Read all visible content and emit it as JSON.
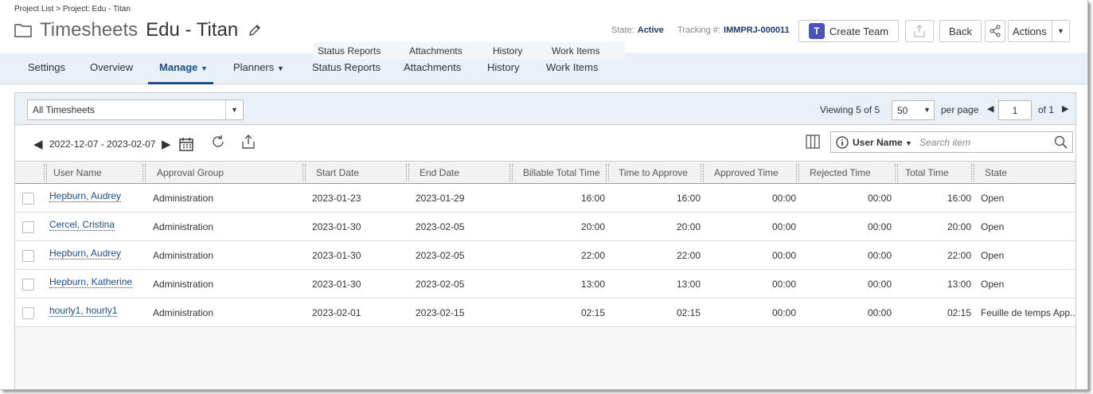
{
  "breadcrumb": "Project List > Project: Edu - Titan",
  "title": {
    "main": "Timesheets",
    "sub": "Edu - Titan"
  },
  "state": {
    "label": "State:",
    "value": "Active"
  },
  "tracking": {
    "label": "Tracking #:",
    "value": "IMMPRJ-000011"
  },
  "buttons": {
    "create_team": "Create Team",
    "back": "Back",
    "actions": "Actions"
  },
  "floating_tabs": [
    "Status Reports",
    "Attachments",
    "History",
    "Work Items"
  ],
  "nav": {
    "settings": "Settings",
    "overview": "Overview",
    "manage": "Manage",
    "planners": "Planners",
    "status_reports": "Status Reports",
    "attachments": "Attachments",
    "history": "History",
    "work_items": "Work Items"
  },
  "filter": {
    "selected": "All Timesheets"
  },
  "paging": {
    "viewing_label": "Viewing",
    "viewing": "5 of 5",
    "per_page_value": "50",
    "per_page_label": "per page",
    "page": "1",
    "of": "of 1"
  },
  "date_range": "2022-12-07 - 2023-02-07",
  "search": {
    "field": "User Name",
    "placeholder": "Search item"
  },
  "columns": [
    "User Name",
    "Approval Group",
    "Start Date",
    "End Date",
    "Billable Total Time",
    "Time to Approve",
    "Approved Time",
    "Rejected Time",
    "Total Time",
    "State"
  ],
  "rows": [
    {
      "user": "Hepburn, Audrey",
      "group": "Administration",
      "start": "2023-01-23",
      "end": "2023-01-29",
      "billable": "16:00",
      "to_approve": "16:00",
      "approved": "00:00",
      "rejected": "00:00",
      "total": "16:00",
      "state": "Open"
    },
    {
      "user": "Cercel, Cristina",
      "group": "Administration",
      "start": "2023-01-30",
      "end": "2023-02-05",
      "billable": "20:00",
      "to_approve": "20:00",
      "approved": "00:00",
      "rejected": "00:00",
      "total": "20:00",
      "state": "Open"
    },
    {
      "user": "Hepburn, Audrey",
      "group": "Administration",
      "start": "2023-01-30",
      "end": "2023-02-05",
      "billable": "22:00",
      "to_approve": "22:00",
      "approved": "00:00",
      "rejected": "00:00",
      "total": "22:00",
      "state": "Open"
    },
    {
      "user": "Hepburn, Katherine",
      "group": "Administration",
      "start": "2023-01-30",
      "end": "2023-02-05",
      "billable": "13:00",
      "to_approve": "13:00",
      "approved": "00:00",
      "rejected": "00:00",
      "total": "13:00",
      "state": "Open"
    },
    {
      "user": "hourly1, hourly1",
      "group": "Administration",
      "start": "2023-02-01",
      "end": "2023-02-15",
      "billable": "02:15",
      "to_approve": "02:15",
      "approved": "00:00",
      "rejected": "00:00",
      "total": "02:15",
      "state": "Feuille de temps App..."
    }
  ],
  "colors": {
    "accent": "#1c4f8a",
    "nav_bg": "#e8f1f8",
    "teams": "#4b53bc"
  },
  "icons": [
    "folder-icon",
    "pencil-icon",
    "teams-icon",
    "export-icon",
    "share-icon",
    "calendar-icon",
    "refresh-icon",
    "columns-icon",
    "info-icon",
    "search-icon"
  ]
}
